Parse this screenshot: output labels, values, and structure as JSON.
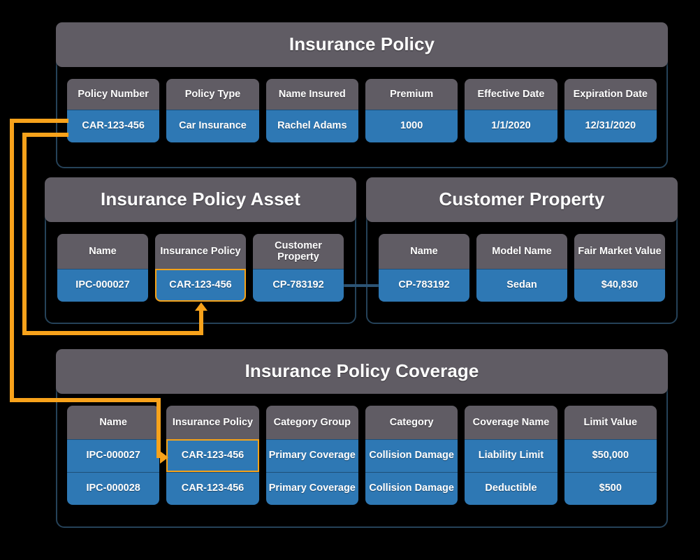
{
  "diagram": {
    "title": "Insurance data model relationship diagram",
    "colors": {
      "background": "#000000",
      "panel_header": "#605c64",
      "panel_border": "#254259",
      "field_header": "#605c64",
      "field_value": "#2e78b4",
      "highlight": "#f7a21b",
      "connector_dark": "#2c5475",
      "text": "#ffffff"
    }
  },
  "entities": {
    "insurance_policy": {
      "title": "Insurance Policy",
      "fields": [
        {
          "header": "Policy Number",
          "values": [
            "CAR-123-456"
          ],
          "highlighted": false
        },
        {
          "header": "Policy Type",
          "values": [
            "Car Insurance"
          ],
          "highlighted": false
        },
        {
          "header": "Name Insured",
          "values": [
            "Rachel Adams"
          ],
          "highlighted": false
        },
        {
          "header": "Premium",
          "values": [
            "1000"
          ],
          "highlighted": false
        },
        {
          "header": "Effective Date",
          "values": [
            "1/1/2020"
          ],
          "highlighted": false
        },
        {
          "header": "Expiration Date",
          "values": [
            "12/31/2020"
          ],
          "highlighted": false
        }
      ]
    },
    "insurance_policy_asset": {
      "title": "Insurance Policy Asset",
      "fields": [
        {
          "header": "Name",
          "values": [
            "IPC-000027"
          ],
          "highlighted": false
        },
        {
          "header": "Insurance Policy",
          "values": [
            "CAR-123-456"
          ],
          "highlighted": true
        },
        {
          "header": "Customer Property",
          "values": [
            "CP-783192"
          ],
          "highlighted": false
        }
      ]
    },
    "customer_property": {
      "title": "Customer Property",
      "fields": [
        {
          "header": "Name",
          "values": [
            "CP-783192"
          ],
          "highlighted": false
        },
        {
          "header": "Model Name",
          "values": [
            "Sedan"
          ],
          "highlighted": false
        },
        {
          "header": "Fair Market Value",
          "values": [
            "$40,830"
          ],
          "highlighted": false
        }
      ]
    },
    "insurance_policy_coverage": {
      "title": "Insurance Policy Coverage",
      "fields": [
        {
          "header": "Name",
          "values": [
            "IPC-000027",
            "IPC-000028"
          ],
          "highlighted": false
        },
        {
          "header": "Insurance Policy",
          "values": [
            "CAR-123-456",
            "CAR-123-456"
          ],
          "highlighted": true
        },
        {
          "header": "Category Group",
          "values": [
            "Primary Coverage",
            "Primary Coverage"
          ],
          "highlighted": false
        },
        {
          "header": "Category",
          "values": [
            "Collision Damage",
            "Collision Damage"
          ],
          "highlighted": false
        },
        {
          "header": "Coverage Name",
          "values": [
            "Liability Limit",
            "Deductible"
          ],
          "highlighted": false
        },
        {
          "header": "Limit Value",
          "values": [
            "$50,000",
            "$500"
          ],
          "highlighted": false
        }
      ]
    }
  },
  "relationships": [
    {
      "name": "policy-to-asset",
      "from": "Insurance Policy.Policy Number = CAR-123-456",
      "to": "Insurance Policy Asset.Insurance Policy = CAR-123-456",
      "style": "orange-arrow"
    },
    {
      "name": "policy-to-coverage",
      "from": "Insurance Policy.Policy Number = CAR-123-456",
      "to": "Insurance Policy Coverage.Insurance Policy = CAR-123-456",
      "style": "orange-arrow"
    },
    {
      "name": "asset-to-customer-property",
      "from": "Insurance Policy Asset.Customer Property = CP-783192",
      "to": "Customer Property.Name = CP-783192",
      "style": "dark-line"
    }
  ]
}
